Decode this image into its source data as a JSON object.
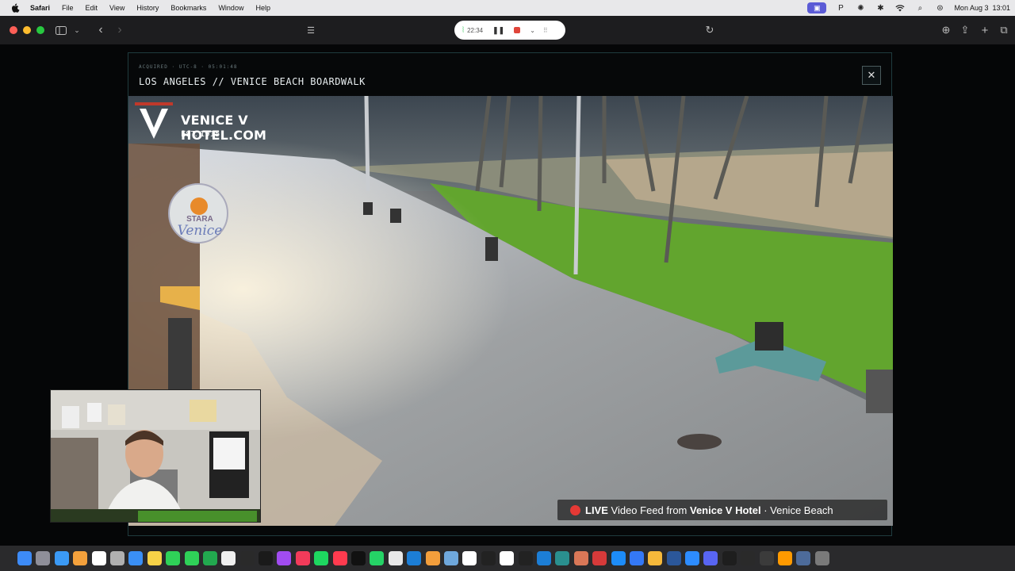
{
  "menubar": {
    "app_name": "Safari",
    "menus": [
      "File",
      "Edit",
      "View",
      "History",
      "Bookmarks",
      "Window",
      "Help"
    ],
    "clock": "Mon Aug 3  13:01"
  },
  "recording": {
    "elapsed": "22:34"
  },
  "camera": {
    "meta": "ACQUIRED · UTC-8 · 05:01:48",
    "title": "LOS ANGELES // VENICE BEACH BOARDWALK",
    "close_label": "✕",
    "logo_text": "VENICE V HOTEL.COM",
    "logo_est": "EST. 1915",
    "sign_top": "STARA",
    "sign_bottom": "Venice",
    "live_label": "LIVE",
    "live_text_1": " Video Feed from ",
    "live_hotel": "Venice V Hotel",
    "live_text_2": " · Venice Beach"
  },
  "dock": {
    "icons": [
      "finder-icon",
      "launchpad-icon",
      "safari-icon",
      "photos-icon",
      "calendar-icon",
      "contacts-icon",
      "mail-icon",
      "notes-icon",
      "messages-icon",
      "facetime-icon",
      "numbers-icon",
      "reminders-icon",
      "stocks-icon",
      "apple-tv-icon",
      "podcasts-icon",
      "music-icon",
      "spotify-icon",
      "news-icon",
      "tiktok-icon",
      "whatsapp-icon",
      "chrome-icon",
      "vscode-icon",
      "pages-icon",
      "preview-icon",
      "chatgpt-icon",
      "cursor-icon",
      "notion-icon",
      "finalcut-icon",
      "xcode-icon",
      "perplexity-icon",
      "claude-icon",
      "affinity-icon",
      "app-store-icon",
      "keynote-icon",
      "sketch-icon",
      "word-icon",
      "zoom-icon",
      "discord-icon",
      "figma-icon",
      "terminal-icon",
      "obs-icon",
      "illustrator-icon",
      "downloads-icon",
      "trash-icon"
    ],
    "colors": [
      "#3d8bf7",
      "#8f8f99",
      "#3b9af5",
      "#f4a13c",
      "#fff",
      "#b0b0b0",
      "#3a8ff5",
      "#f7d247",
      "#2fd158",
      "#2fd158",
      "#22a94f",
      "#f0f0f0",
      "#2a2a2a",
      "#1a1a1a",
      "#a14cf0",
      "#f23b5a",
      "#1ed760",
      "#ff3b4f",
      "#111",
      "#25d366",
      "#e8e8e8",
      "#1c7ed6",
      "#f29e3c",
      "#6fa8dc",
      "#fff",
      "#222",
      "#fff",
      "#222",
      "#1c7ed6",
      "#2a8f8f",
      "#d97757",
      "#d63a3a",
      "#1d8cf8",
      "#3478f6",
      "#f6b93b",
      "#2b579a",
      "#2d8cff",
      "#5865f2",
      "#1e1e1e",
      "#2a2a2a",
      "#3b3b3b",
      "#ff9a00",
      "#4d6b9a",
      "#7a7a7a"
    ]
  }
}
